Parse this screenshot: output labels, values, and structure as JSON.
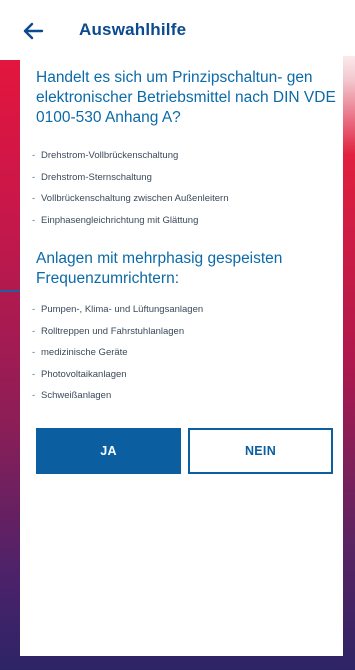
{
  "header": {
    "back_icon": "arrow-left-icon",
    "title": "Auswahlhilfe"
  },
  "section1": {
    "heading": "Handelt es sich um Prinzipschaltun- gen elektronischer Betriebsmittel nach DIN VDE 0100-530 Anhang A?",
    "items": [
      "Drehstrom-Vollbrückenschaltung",
      "Drehstrom-Sternschaltung",
      "Vollbrückenschaltung zwischen Außenleitern",
      "Einphasengleichrichtung mit Glättung"
    ]
  },
  "section2": {
    "heading": "Anlagen mit mehrphasig gespeisten Frequenzumrichtern:",
    "items": [
      "Pumpen-, Klima- und Lüftungsanlagen",
      "Rolltreppen und Fahrstuhlanlagen",
      "medizinische Geräte",
      "Photovoltaikanlagen",
      "Schweißanlagen"
    ]
  },
  "buttons": {
    "yes_label": "JA",
    "no_label": "NEIN"
  },
  "colors": {
    "primary_blue": "#0b5fa0",
    "heading_blue": "#0b6aa8",
    "gradient_red": "#e3163d",
    "gradient_purple": "#2d2466"
  }
}
